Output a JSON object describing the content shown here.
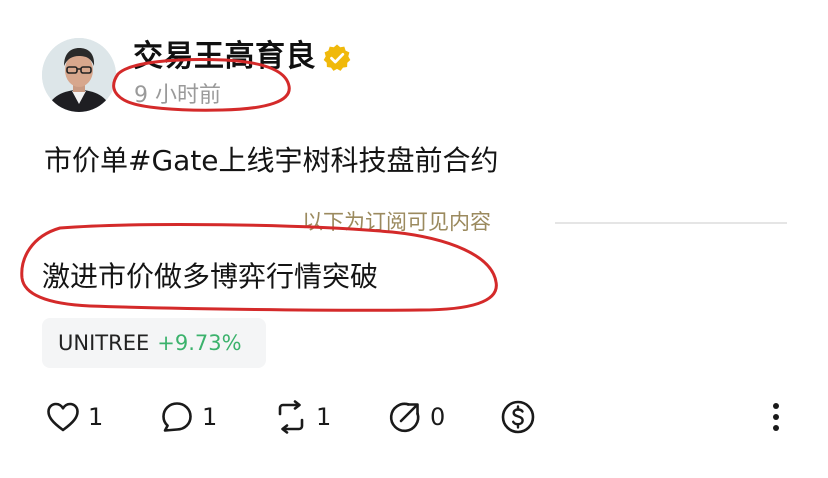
{
  "post": {
    "author_name": "交易王高育良",
    "timestamp": "9 小时前",
    "text": "市价单#Gate上线宇树科技盘前合约",
    "subscriber_divider": "以下为订阅可见内容",
    "subscriber_text": "激进市价做多博弈行情突破"
  },
  "ticker": {
    "symbol": "UNITREE",
    "change": "+9.73%"
  },
  "actions": {
    "like_count": "1",
    "comment_count": "1",
    "repost_count": "1",
    "share_count": "0"
  },
  "icons": {
    "verified": "verified-badge-icon",
    "like": "heart-icon",
    "comment": "comment-bubble-icon",
    "repost": "repost-icon",
    "share": "share-arrow-icon",
    "tip": "dollar-tip-icon",
    "more": "more-vertical-icon"
  },
  "colors": {
    "positive_change": "#3bb26c",
    "verified_badge": "#f0b90b",
    "divider_label": "#9b8a5e",
    "annotation": "#d42a2a",
    "timestamp": "#9a9a9a"
  }
}
